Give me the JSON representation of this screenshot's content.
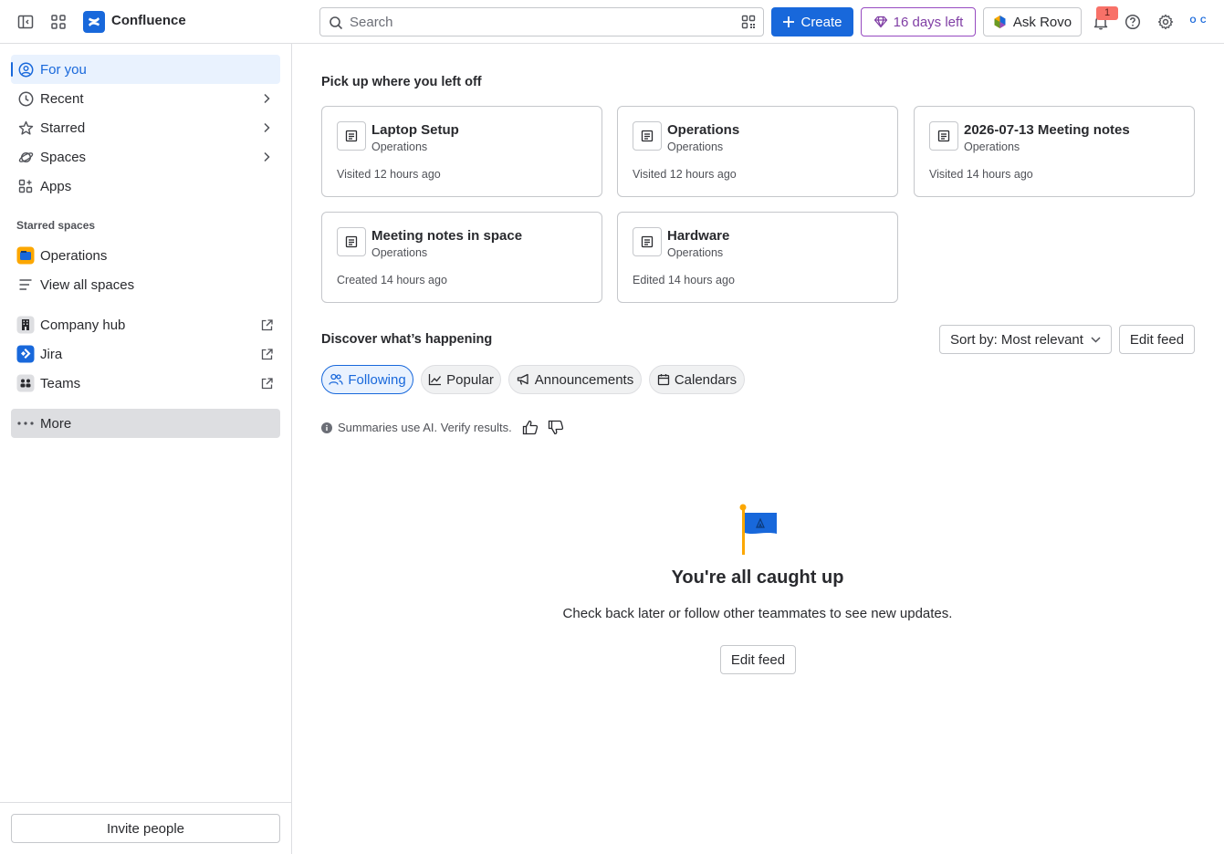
{
  "header": {
    "brand": "Confluence",
    "search_placeholder": "Search",
    "create_label": "Create",
    "trial_label": "16 days left",
    "rovo_label": "Ask Rovo",
    "notification_count": "1",
    "avatar_initials": "O C"
  },
  "sidebar": {
    "items": [
      {
        "label": "For you"
      },
      {
        "label": "Recent"
      },
      {
        "label": "Starred"
      },
      {
        "label": "Spaces"
      },
      {
        "label": "Apps"
      }
    ],
    "starred_spaces_label": "Starred spaces",
    "starred_spaces": [
      {
        "label": "Operations"
      },
      {
        "label": "View all spaces"
      }
    ],
    "links": [
      {
        "label": "Company hub"
      },
      {
        "label": "Jira"
      },
      {
        "label": "Teams"
      }
    ],
    "more_label": "More",
    "invite_label": "Invite people"
  },
  "main": {
    "pickup_heading": "Pick up where you left off",
    "cards": [
      {
        "title": "Laptop Setup",
        "space": "Operations",
        "meta": "Visited 12 hours ago"
      },
      {
        "title": "Operations",
        "space": "Operations",
        "meta": "Visited 12 hours ago"
      },
      {
        "title": "2026-07-13 Meeting notes",
        "space": "Operations",
        "meta": "Visited 14 hours ago"
      },
      {
        "title": "Meeting notes in space",
        "space": "Operations",
        "meta": "Created 14 hours ago"
      },
      {
        "title": "Hardware",
        "space": "Operations",
        "meta": "Edited 14 hours ago"
      }
    ],
    "discover_heading": "Discover what’s happening",
    "sort_label": "Sort by: Most relevant",
    "edit_feed_label": "Edit feed",
    "chips": [
      {
        "label": "Following",
        "selected": true
      },
      {
        "label": "Popular",
        "selected": false
      },
      {
        "label": "Announcements",
        "selected": false
      },
      {
        "label": "Calendars",
        "selected": false
      }
    ],
    "ai_note": "Summaries use AI. Verify results.",
    "empty_title": "You're all caught up",
    "empty_subtitle": "Check back later or follow other teammates to see new updates.",
    "empty_button": "Edit feed"
  },
  "colors": {
    "accent": "#1868db",
    "trial": "#803fa5",
    "badge": "#f87168",
    "active_bg": "#e9f2fe"
  }
}
